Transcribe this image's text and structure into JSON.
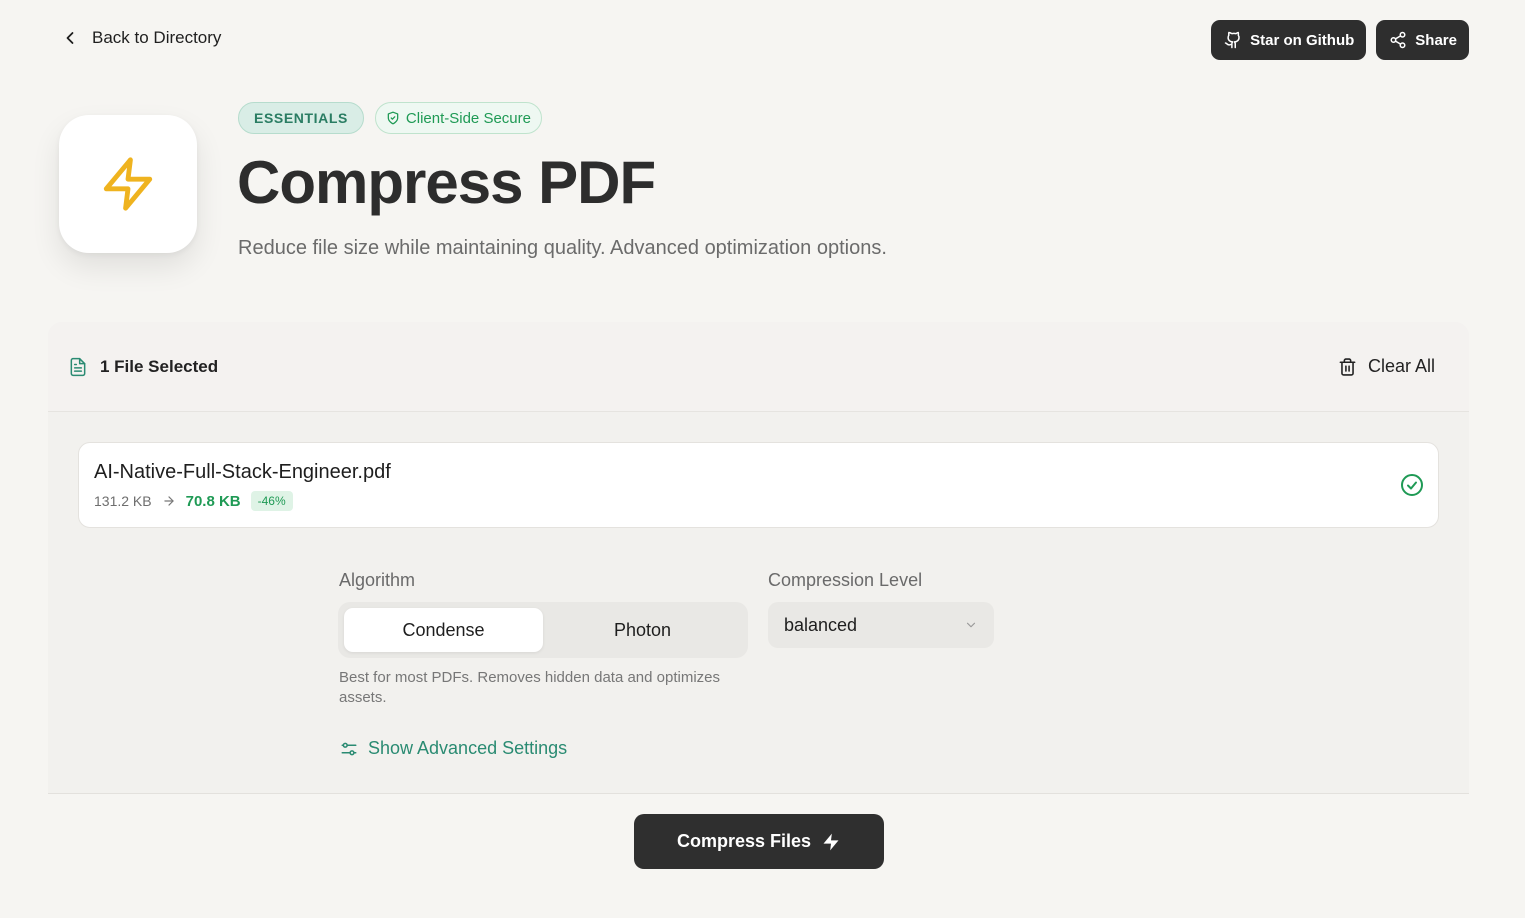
{
  "nav": {
    "back_label": "Back to Directory",
    "github_label": "Star on Github",
    "share_label": "Share"
  },
  "hero": {
    "icon": "lightning-bolt-icon",
    "badges": [
      "ESSENTIALS",
      "Client-Side Secure"
    ],
    "title": "Compress PDF",
    "subtitle": "Reduce file size while maintaining quality. Advanced optimization options."
  },
  "files": {
    "selected_label": "1 File Selected",
    "clear_label": "Clear All",
    "items": [
      {
        "name": "AI-Native-Full-Stack-Engineer.pdf",
        "original_size": "131.2 KB",
        "compressed_size": "70.8 KB",
        "reduction": "-46%",
        "status": "done"
      }
    ]
  },
  "settings": {
    "algorithm_label": "Algorithm",
    "algorithms": [
      "Condense",
      "Photon"
    ],
    "selected_algorithm": "Condense",
    "algorithm_description": "Best for most PDFs. Removes hidden data and optimizes assets.",
    "level_label": "Compression Level",
    "level_value": "balanced",
    "advanced_label": "Show Advanced Settings"
  },
  "actions": {
    "compress_label": "Compress Files"
  },
  "colors": {
    "accent_green": "#1f9a55",
    "teal": "#2a8b72",
    "icon_yellow": "#efb31f",
    "dark_button": "#2e2e2e"
  }
}
